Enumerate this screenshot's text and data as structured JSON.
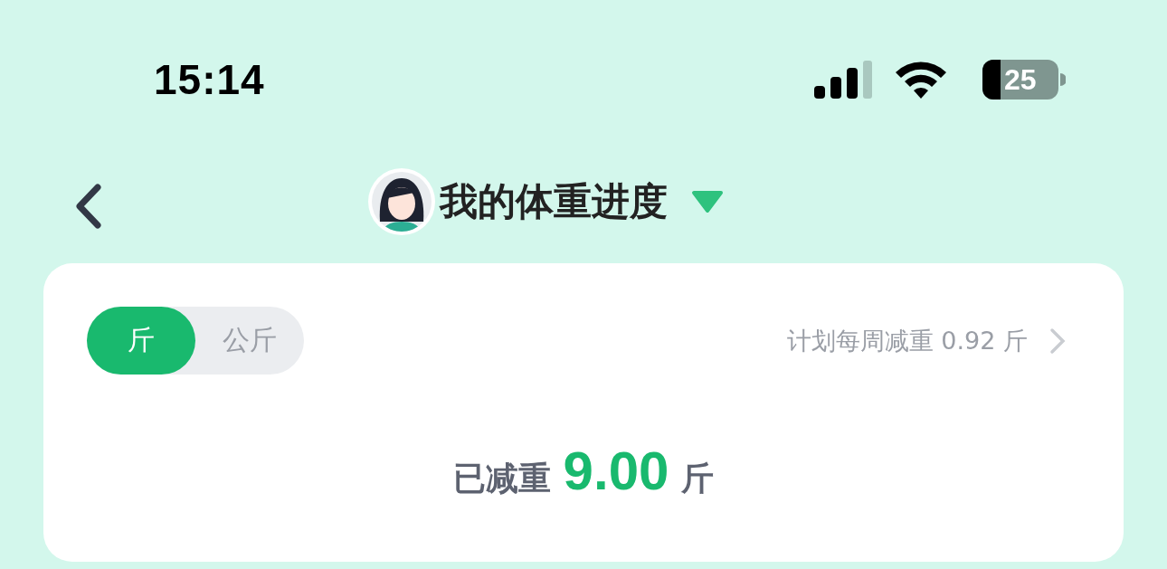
{
  "status_bar": {
    "time": "15:14",
    "battery": "25"
  },
  "header": {
    "title": "我的体重进度"
  },
  "card": {
    "units": [
      {
        "label": "斤",
        "selected": true
      },
      {
        "label": "公斤",
        "selected": false
      }
    ],
    "plan": "计划每周减重 0.92 斤",
    "lost_label": "已减重",
    "lost_value": "9.00",
    "lost_unit": "斤"
  }
}
